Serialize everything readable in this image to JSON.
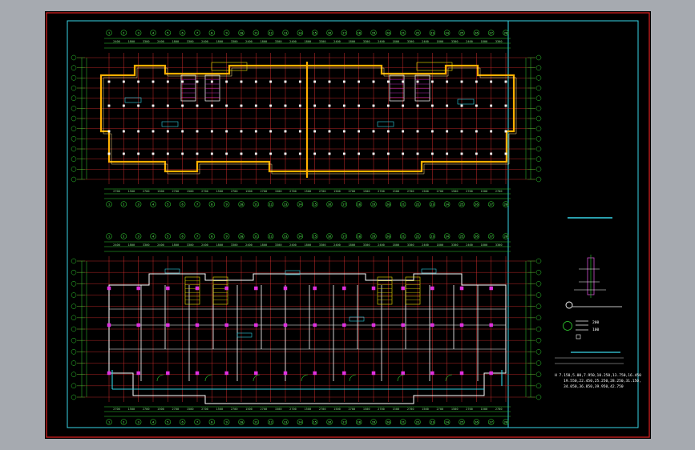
{
  "drawing": {
    "background": "#000000",
    "frame_color": "#e02020",
    "inner_frame_color": "#39d6e8",
    "colors": {
      "grid": "#e03030",
      "wall": "#ffffff",
      "beam": "#ffb000",
      "green": "#30d030",
      "cyan": "#30d0e0",
      "magenta": "#e030e0",
      "yellow": "#f0e000"
    },
    "top_plan": {
      "axis_labels": [
        "1",
        "2",
        "3",
        "4",
        "5",
        "6",
        "7",
        "8",
        "9",
        "10",
        "11",
        "12",
        "13",
        "14",
        "15",
        "16",
        "17",
        "18",
        "19",
        "20",
        "21",
        "22",
        "23",
        "24",
        "25",
        "26",
        "27",
        "28"
      ]
    },
    "bottom_plan": {
      "axis_labels": [
        "1",
        "2",
        "3",
        "4",
        "5",
        "6",
        "7",
        "8",
        "9",
        "10",
        "11",
        "12",
        "13",
        "14",
        "15",
        "16",
        "17",
        "18",
        "19",
        "20",
        "21",
        "22",
        "23",
        "24",
        "25",
        "26",
        "27",
        "28"
      ]
    },
    "legend": {
      "row1_value": "200",
      "row2_value": "100",
      "notes": [
        "H  7.150,5.00,7.950,10.250,13.750,16.450",
        "19.550,22.450,25.250,28.250,31.150,",
        "34.050,36.850,39.950,42.750"
      ]
    }
  }
}
